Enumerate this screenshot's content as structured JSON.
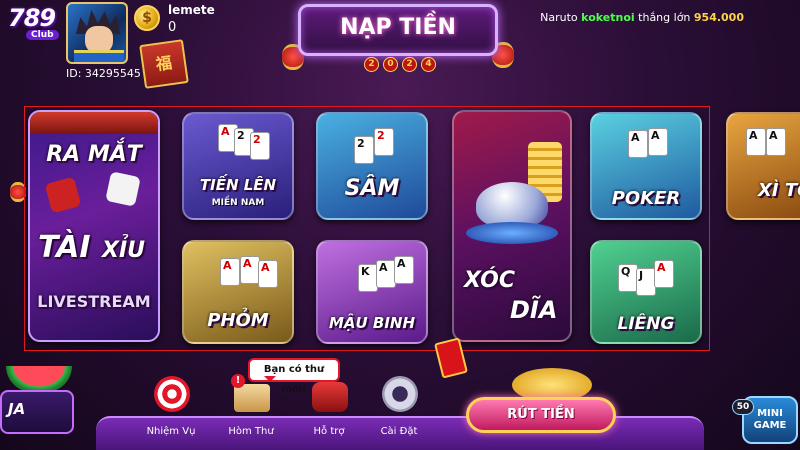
{
  "header": {
    "logo_number": "789",
    "logo_club": "Club",
    "player_id": "ID: 34295545",
    "username": "lemete",
    "balance": "0",
    "coin_symbol": "$",
    "scroll_glyph": "福",
    "banner_title": "NẠP TIỀN",
    "banner_year": [
      "2",
      "0",
      "2",
      "4"
    ],
    "ticker": {
      "name": "Naruto",
      "winner": "koketnoi",
      "verb": "thắng lớn",
      "amount": "954.000"
    }
  },
  "games": {
    "tai_xiu": {
      "top": "RA MẮT",
      "main_a": "TÀI",
      "main_b": "XỈU",
      "bottom": "LIVESTREAM"
    },
    "tien_len": {
      "label": "TIẾN LÊN",
      "sub": "MIỀN NAM"
    },
    "sam": {
      "label": "SÂM"
    },
    "xoc_dia": {
      "line1": "XÓC",
      "line2": "DĨA"
    },
    "poker": {
      "label": "POKER"
    },
    "xi_to": {
      "label": "XÌ TỐ"
    },
    "phom": {
      "label": "PHỎM"
    },
    "mau_binh": {
      "label": "MẬU BINH"
    },
    "lieng": {
      "label": "LIÊNG"
    }
  },
  "bottom": {
    "ja_label": "JA",
    "nav": [
      {
        "label": "Nhiệm Vụ"
      },
      {
        "label": "Hòm Thư"
      },
      {
        "label": "Hỗ trợ"
      },
      {
        "label": "Cài Đặt"
      }
    ],
    "mail_bubble": "Bạn có thư mới!",
    "alert_glyph": "!",
    "withdraw_label": "RÚT TIỀN",
    "minigame_count": "50",
    "minigame_line1": "MINI",
    "minigame_line2": "GAME"
  },
  "colors": {
    "accent": "#c76bff",
    "winner": "#4cff4c",
    "amount": "#ffd24a",
    "frame": "#e21b1b"
  }
}
